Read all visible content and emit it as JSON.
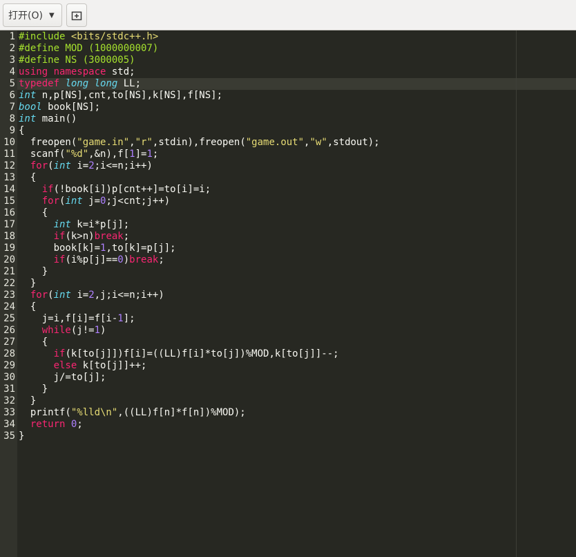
{
  "toolbar": {
    "open_label": "打开(O)",
    "open_caret_icon": "chevron-down-icon",
    "new_tab_icon": "new-tab-icon"
  },
  "editor": {
    "current_line": 5,
    "lines": [
      {
        "n": "1",
        "tokens": [
          {
            "t": "#include ",
            "s": "preproc"
          },
          {
            "t": "<bits/stdc++.h>",
            "s": "string"
          }
        ]
      },
      {
        "n": "2",
        "tokens": [
          {
            "t": "#define MOD (1000000007)",
            "s": "preproc"
          }
        ]
      },
      {
        "n": "3",
        "tokens": [
          {
            "t": "#define NS (3000005)",
            "s": "preproc"
          }
        ]
      },
      {
        "n": "4",
        "tokens": [
          {
            "t": "using namespace",
            "s": "keyword"
          },
          {
            "t": " std;",
            "s": "plain"
          }
        ]
      },
      {
        "n": "5",
        "tokens": [
          {
            "t": "typedef",
            "s": "keyword"
          },
          {
            "t": " ",
            "s": "plain"
          },
          {
            "t": "long long",
            "s": "type"
          },
          {
            "t": " LL;",
            "s": "plain"
          }
        ]
      },
      {
        "n": "6",
        "tokens": [
          {
            "t": "int",
            "s": "type"
          },
          {
            "t": " n,p[NS],cnt,to[NS],k[NS],f[NS];",
            "s": "plain"
          }
        ]
      },
      {
        "n": "7",
        "tokens": [
          {
            "t": "bool",
            "s": "type"
          },
          {
            "t": " book[NS];",
            "s": "plain"
          }
        ]
      },
      {
        "n": "8",
        "tokens": [
          {
            "t": "int",
            "s": "type"
          },
          {
            "t": " main()",
            "s": "plain"
          }
        ]
      },
      {
        "n": "9",
        "tokens": [
          {
            "t": "{",
            "s": "plain"
          }
        ]
      },
      {
        "n": "10",
        "tokens": [
          {
            "t": "  freopen(",
            "s": "plain"
          },
          {
            "t": "\"game.in\"",
            "s": "string"
          },
          {
            "t": ",",
            "s": "plain"
          },
          {
            "t": "\"r\"",
            "s": "string"
          },
          {
            "t": ",stdin),freopen(",
            "s": "plain"
          },
          {
            "t": "\"game.out\"",
            "s": "string"
          },
          {
            "t": ",",
            "s": "plain"
          },
          {
            "t": "\"w\"",
            "s": "string"
          },
          {
            "t": ",stdout);",
            "s": "plain"
          }
        ]
      },
      {
        "n": "11",
        "tokens": [
          {
            "t": "  scanf(",
            "s": "plain"
          },
          {
            "t": "\"%d\"",
            "s": "string"
          },
          {
            "t": ",&n),f[",
            "s": "plain"
          },
          {
            "t": "1",
            "s": "number"
          },
          {
            "t": "]=",
            "s": "plain"
          },
          {
            "t": "1",
            "s": "number"
          },
          {
            "t": ";",
            "s": "plain"
          }
        ]
      },
      {
        "n": "12",
        "tokens": [
          {
            "t": "  ",
            "s": "plain"
          },
          {
            "t": "for",
            "s": "keyword"
          },
          {
            "t": "(",
            "s": "plain"
          },
          {
            "t": "int",
            "s": "type"
          },
          {
            "t": " i=",
            "s": "plain"
          },
          {
            "t": "2",
            "s": "number"
          },
          {
            "t": ";i<=n;i++)",
            "s": "plain"
          }
        ]
      },
      {
        "n": "13",
        "tokens": [
          {
            "t": "  {",
            "s": "plain"
          }
        ]
      },
      {
        "n": "14",
        "tokens": [
          {
            "t": "    ",
            "s": "plain"
          },
          {
            "t": "if",
            "s": "keyword"
          },
          {
            "t": "(!book[i])p[cnt++]=to[i]=i;",
            "s": "plain"
          }
        ]
      },
      {
        "n": "15",
        "tokens": [
          {
            "t": "    ",
            "s": "plain"
          },
          {
            "t": "for",
            "s": "keyword"
          },
          {
            "t": "(",
            "s": "plain"
          },
          {
            "t": "int",
            "s": "type"
          },
          {
            "t": " j=",
            "s": "plain"
          },
          {
            "t": "0",
            "s": "number"
          },
          {
            "t": ";j<cnt;j++)",
            "s": "plain"
          }
        ]
      },
      {
        "n": "16",
        "tokens": [
          {
            "t": "    {",
            "s": "plain"
          }
        ]
      },
      {
        "n": "17",
        "tokens": [
          {
            "t": "      ",
            "s": "plain"
          },
          {
            "t": "int",
            "s": "type"
          },
          {
            "t": " k=i*p[j];",
            "s": "plain"
          }
        ]
      },
      {
        "n": "18",
        "tokens": [
          {
            "t": "      ",
            "s": "plain"
          },
          {
            "t": "if",
            "s": "keyword"
          },
          {
            "t": "(k>n)",
            "s": "plain"
          },
          {
            "t": "break",
            "s": "keyword"
          },
          {
            "t": ";",
            "s": "plain"
          }
        ]
      },
      {
        "n": "19",
        "tokens": [
          {
            "t": "      book[k]=",
            "s": "plain"
          },
          {
            "t": "1",
            "s": "number"
          },
          {
            "t": ",to[k]=p[j];",
            "s": "plain"
          }
        ]
      },
      {
        "n": "20",
        "tokens": [
          {
            "t": "      ",
            "s": "plain"
          },
          {
            "t": "if",
            "s": "keyword"
          },
          {
            "t": "(i%p[j]==",
            "s": "plain"
          },
          {
            "t": "0",
            "s": "number"
          },
          {
            "t": ")",
            "s": "plain"
          },
          {
            "t": "break",
            "s": "keyword"
          },
          {
            "t": ";",
            "s": "plain"
          }
        ]
      },
      {
        "n": "21",
        "tokens": [
          {
            "t": "    }",
            "s": "plain"
          }
        ]
      },
      {
        "n": "22",
        "tokens": [
          {
            "t": "  }",
            "s": "plain"
          }
        ]
      },
      {
        "n": "23",
        "tokens": [
          {
            "t": "  ",
            "s": "plain"
          },
          {
            "t": "for",
            "s": "keyword"
          },
          {
            "t": "(",
            "s": "plain"
          },
          {
            "t": "int",
            "s": "type"
          },
          {
            "t": " i=",
            "s": "plain"
          },
          {
            "t": "2",
            "s": "number"
          },
          {
            "t": ",j;i<=n;i++)",
            "s": "plain"
          }
        ]
      },
      {
        "n": "24",
        "tokens": [
          {
            "t": "  {",
            "s": "plain"
          }
        ]
      },
      {
        "n": "25",
        "tokens": [
          {
            "t": "    j=i,f[i]=f[i-",
            "s": "plain"
          },
          {
            "t": "1",
            "s": "number"
          },
          {
            "t": "];",
            "s": "plain"
          }
        ]
      },
      {
        "n": "26",
        "tokens": [
          {
            "t": "    ",
            "s": "plain"
          },
          {
            "t": "while",
            "s": "keyword"
          },
          {
            "t": "(j!=",
            "s": "plain"
          },
          {
            "t": "1",
            "s": "number"
          },
          {
            "t": ")",
            "s": "plain"
          }
        ]
      },
      {
        "n": "27",
        "tokens": [
          {
            "t": "    {",
            "s": "plain"
          }
        ]
      },
      {
        "n": "28",
        "tokens": [
          {
            "t": "      ",
            "s": "plain"
          },
          {
            "t": "if",
            "s": "keyword"
          },
          {
            "t": "(k[to[j]])f[i]=((LL)f[i]*to[j])%MOD,k[to[j]]--;",
            "s": "plain"
          }
        ]
      },
      {
        "n": "29",
        "tokens": [
          {
            "t": "      ",
            "s": "plain"
          },
          {
            "t": "else",
            "s": "keyword"
          },
          {
            "t": " k[to[j]]++;",
            "s": "plain"
          }
        ]
      },
      {
        "n": "30",
        "tokens": [
          {
            "t": "      j/=to[j];",
            "s": "plain"
          }
        ]
      },
      {
        "n": "31",
        "tokens": [
          {
            "t": "    }",
            "s": "plain"
          }
        ]
      },
      {
        "n": "32",
        "tokens": [
          {
            "t": "  }",
            "s": "plain"
          }
        ]
      },
      {
        "n": "33",
        "tokens": [
          {
            "t": "  printf(",
            "s": "plain"
          },
          {
            "t": "\"%lld\\n\"",
            "s": "string"
          },
          {
            "t": ",((LL)f[n]*f[n])%MOD);",
            "s": "plain"
          }
        ]
      },
      {
        "n": "34",
        "tokens": [
          {
            "t": "  ",
            "s": "plain"
          },
          {
            "t": "return",
            "s": "keyword"
          },
          {
            "t": " ",
            "s": "plain"
          },
          {
            "t": "0",
            "s": "number"
          },
          {
            "t": ";",
            "s": "plain"
          }
        ]
      },
      {
        "n": "35",
        "tokens": [
          {
            "t": "}",
            "s": "plain"
          }
        ]
      }
    ]
  }
}
